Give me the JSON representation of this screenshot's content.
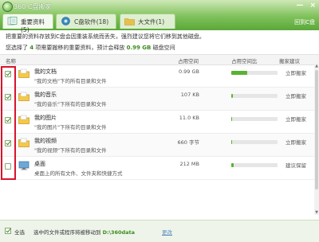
{
  "window": {
    "title": "360 C盘搬家",
    "controls": [
      "—",
      "×"
    ],
    "back_link": "回到C盘"
  },
  "tabs": [
    {
      "label": "重要资料(5)",
      "active": true,
      "icon": "documents-icon"
    },
    {
      "label": "C盘软件(18)",
      "active": false,
      "icon": "disk-icon"
    },
    {
      "label": "大文件(1)",
      "active": false,
      "icon": "folder-icon"
    }
  ],
  "info": {
    "line1": "把重要的资料存放到C盘会因重装系统而丢失，强烈建议您将它们移到其他磁盘。",
    "line2_pre": "您选择了",
    "count": "4",
    "line2_mid": "项需要搬移的重要资料，预计会释放",
    "space": "0.99 GB",
    "line2_post": "磁盘空间"
  },
  "columns": {
    "name": "名称",
    "size": "占用空间",
    "ratio": "占用空间比",
    "suggestion": "搬家建议"
  },
  "rows": [
    {
      "name": "我的文档",
      "desc": "\"我的文档\"下的所有目录和文件",
      "size": "0.99 GB",
      "ratio": 0.35,
      "suggestion": "立即搬家",
      "checked": true
    },
    {
      "name": "我的音乐",
      "desc": "\"我的音乐\"下所有的目录和文件",
      "size": "107 KB",
      "ratio": 0.03,
      "suggestion": "立即搬家",
      "checked": true
    },
    {
      "name": "我的图片",
      "desc": "\"我的图片\"下所有的目录和文件",
      "size": "11.0 KB",
      "ratio": 0.02,
      "suggestion": "立即搬家",
      "checked": true
    },
    {
      "name": "我的视频",
      "desc": "\"我的视频\"下所有的目录和文件",
      "size": "660 字节",
      "ratio": 0.02,
      "suggestion": "立即搬家",
      "checked": true
    },
    {
      "name": "桌面",
      "desc": "桌面上的所有文件、文件夹和快捷方式",
      "size": "212 MB",
      "ratio": 0.05,
      "suggestion": "建议保留",
      "checked": false
    }
  ],
  "footer": {
    "select_all": "全选",
    "select_all_checked": true,
    "move_text": "选中的文件或程序将被移动到",
    "path": "D:\\360data",
    "change": "更改"
  },
  "colors": {
    "accent": "#59b234",
    "highlight_border": "#d8132c"
  }
}
